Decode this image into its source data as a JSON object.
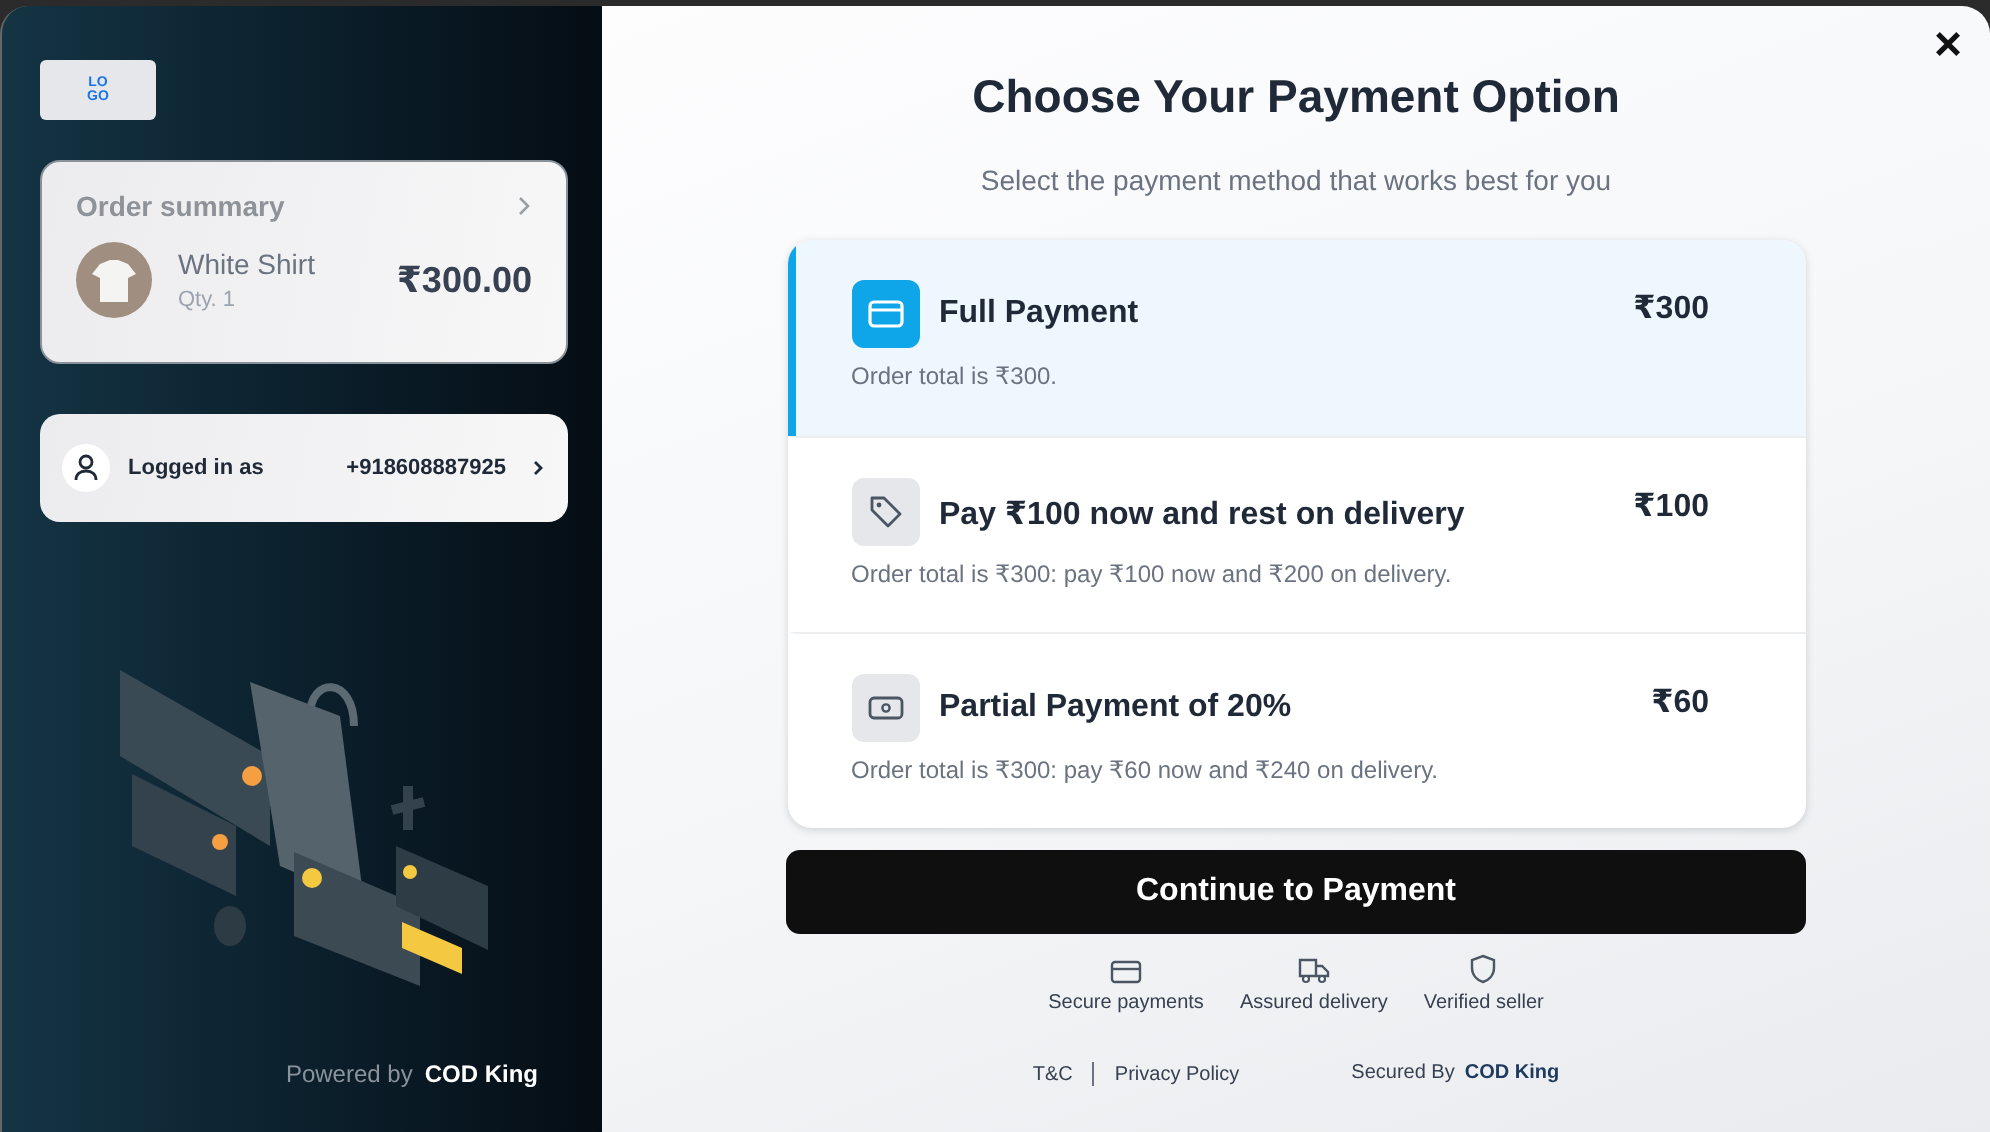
{
  "sidebar": {
    "logo": [
      "LO",
      "GO"
    ],
    "order_summary": {
      "title": "Order summary",
      "product": "White Shirt",
      "quantity": "Qty. 1",
      "price": "₹300.00"
    },
    "login": {
      "label": "Logged in as",
      "phone": "+918608887925"
    },
    "powered_by": {
      "label": "Powered by",
      "brand": "COD King"
    }
  },
  "main": {
    "close": "×",
    "title": "Choose Your Payment Option",
    "subtitle": "Select the payment method that works best for you",
    "options": [
      {
        "kind": "card",
        "title": "Full Payment",
        "amount": "₹300",
        "description": "Order total is ₹300.",
        "selected": true
      },
      {
        "kind": "tag",
        "title": "Pay ₹100 now and rest on delivery",
        "amount": "₹100",
        "description": "Order total is ₹300: pay ₹100 now and ₹200 on delivery.",
        "selected": false
      },
      {
        "kind": "cash",
        "title": "Partial Payment of 20%",
        "amount": "₹60",
        "description": "Order total is ₹300: pay ₹60 now and ₹240 on delivery.",
        "selected": false
      }
    ],
    "continue_button": "Continue to Payment",
    "trust_badges": [
      {
        "kind": "card",
        "label": "Secure payments"
      },
      {
        "kind": "truck",
        "label": "Assured delivery"
      },
      {
        "kind": "shield",
        "label": "Verified seller"
      }
    ],
    "footer": {
      "links": [
        "T&C",
        "Privacy Policy"
      ],
      "secured_label": "Secured By",
      "secured_brand": "COD King"
    }
  }
}
